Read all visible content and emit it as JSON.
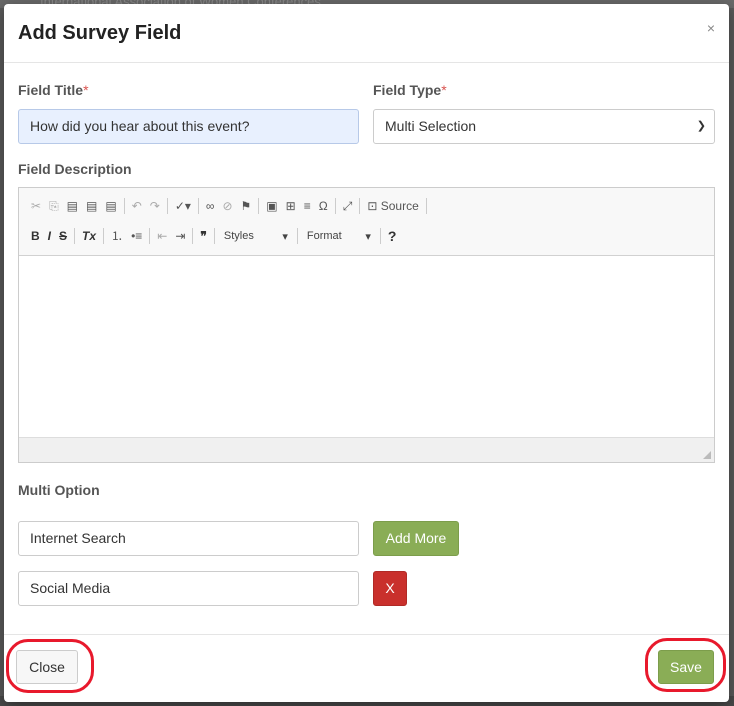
{
  "background": {
    "top_text": "International Association of Women Conferences"
  },
  "modal": {
    "title": "Add Survey Field",
    "close_symbol": "×"
  },
  "form": {
    "field_title": {
      "label": "Field Title",
      "required": "*",
      "value": "How did you hear about this event?"
    },
    "field_type": {
      "label": "Field Type",
      "required": "*",
      "value": "Multi Selection"
    },
    "field_description": {
      "label": "Field Description"
    },
    "multi_option": {
      "label": "Multi Option",
      "options": [
        "Internet Search",
        "Social Media"
      ],
      "add_more_label": "Add More",
      "remove_label": "X"
    }
  },
  "editor": {
    "source_label": "Source",
    "styles_label": "Styles",
    "format_label": "Format",
    "help_label": "?"
  },
  "footer": {
    "close_label": "Close",
    "save_label": "Save"
  },
  "colors": {
    "accent_green": "#8aad56",
    "danger_red": "#c9302c",
    "highlight_red": "#e8192c",
    "active_input": "#e8f0fe"
  }
}
